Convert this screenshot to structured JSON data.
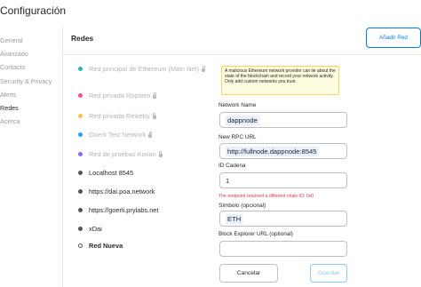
{
  "header": {
    "title": "Configuración"
  },
  "sidebar": {
    "items": [
      {
        "label": "General",
        "active": false
      },
      {
        "label": "Avanzado",
        "active": false
      },
      {
        "label": "Contacts",
        "active": false
      },
      {
        "label": "Security & Privacy",
        "active": false
      },
      {
        "label": "Alerts",
        "active": false
      },
      {
        "label": "Redes",
        "active": true
      },
      {
        "label": "Acerca",
        "active": false
      }
    ]
  },
  "main": {
    "title": "Redes",
    "add_button": "Añadir Red"
  },
  "networks": [
    {
      "label": "Red principal de Ethereum (Main Net)",
      "color": "#29b6af",
      "locked": true
    },
    {
      "label": "Red privada Ropsten",
      "color": "#ff4a8d",
      "locked": true
    },
    {
      "label": "Red privada Rinkeby",
      "color": "#f6c343",
      "locked": true
    },
    {
      "label": "Goerli Test Network",
      "color": "#3099f2",
      "locked": true
    },
    {
      "label": "Red de pruebas Kovan",
      "color": "#9064ff",
      "locked": true
    },
    {
      "label": "Localhost 8545",
      "color": "#555555",
      "locked": false
    },
    {
      "label": "https://dai.poa.network",
      "color": "#555555",
      "locked": false
    },
    {
      "label": "https://goerli.prylabs.net",
      "color": "#555555",
      "locked": false
    },
    {
      "label": "xDai",
      "color": "#555555",
      "locked": false
    },
    {
      "label": "Red Nueva",
      "color": "#ffffff",
      "locked": false
    }
  ],
  "form": {
    "warning": "A malicious Ethereum network provider can lie about the state of the blockchain and record your network activity. Only add custom networks you trust.",
    "network_name_label": "Network Name",
    "network_name_value": "dappnode",
    "rpc_label": "New RPC URL",
    "rpc_value": "http://fullnode.dappnode:8545",
    "chain_id_label": "ID Cadena",
    "chain_id_value": "1",
    "chain_id_error": "The endpoint returned a different chain ID: 0x0",
    "symbol_label": "Símbolo (opcional)",
    "symbol_value": "ETH",
    "explorer_label": "Block Explorer URL (optional)",
    "explorer_value": "",
    "cancel_label": "Cancelar",
    "save_label": "Guardar"
  },
  "colors": {
    "accent": "#037dd6",
    "error": "#d73a49",
    "warning_bg": "#fefcde",
    "warning_border": "#fecf62"
  }
}
